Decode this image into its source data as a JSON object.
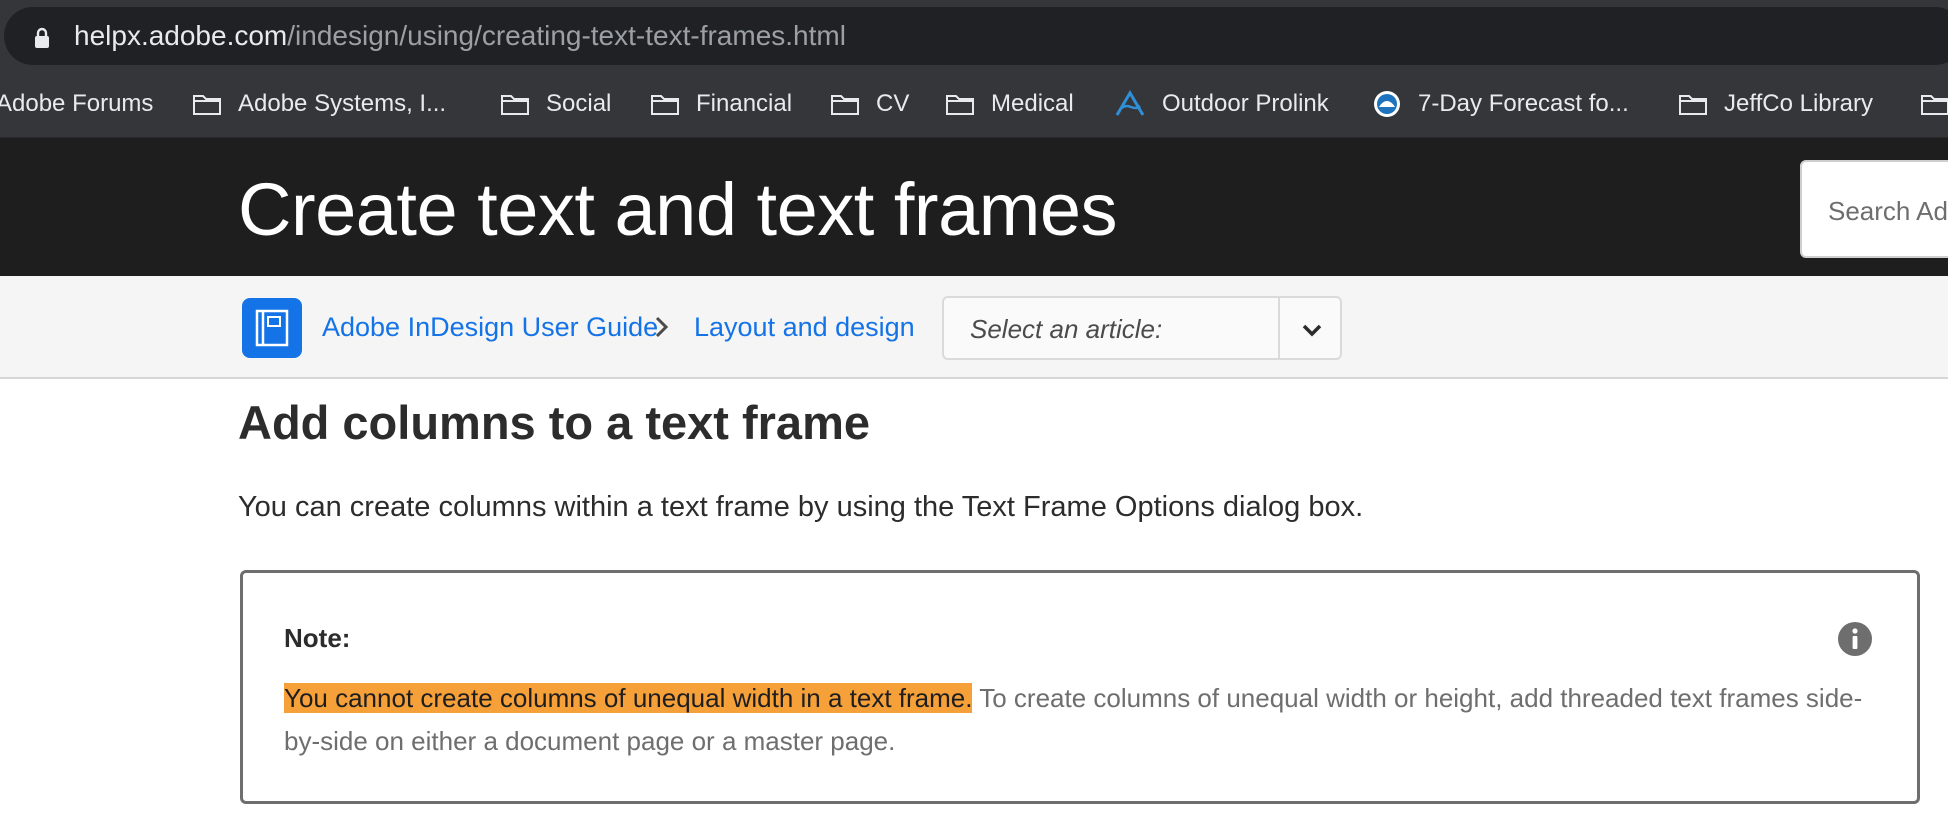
{
  "browser": {
    "url_host": "helpx.adobe.com",
    "url_path": "/indesign/using/creating-text-text-frames.html",
    "bookmarks": [
      {
        "label": "Adobe Forums",
        "icon": "none"
      },
      {
        "label": "Adobe Systems, I...",
        "icon": "folder-icon"
      },
      {
        "label": "Social",
        "icon": "folder-icon"
      },
      {
        "label": "Financial",
        "icon": "folder-icon"
      },
      {
        "label": "CV",
        "icon": "folder-icon"
      },
      {
        "label": "Medical",
        "icon": "folder-icon"
      },
      {
        "label": "Outdoor Prolink",
        "icon": "prolink-logo-icon"
      },
      {
        "label": "7-Day Forecast fo...",
        "icon": "noaa-logo-icon"
      },
      {
        "label": "JeffCo Library",
        "icon": "folder-icon"
      }
    ]
  },
  "header": {
    "title": "Create text and text frames",
    "search_placeholder": "Search Adobe"
  },
  "breadcrumb": {
    "guide_label": "Adobe InDesign User Guide",
    "section_label": "Layout and design",
    "article_select_placeholder": "Select an article:"
  },
  "main": {
    "heading": "Add columns to a text frame",
    "intro": "You can create columns within a text frame by using the Text Frame Options dialog box.",
    "note": {
      "label": "Note:",
      "highlighted_text": "You cannot create columns of unequal width in a text frame.",
      "body_text": " To create columns of unequal width or height, add threaded text frames side-by-side on either a document page or a master page."
    }
  },
  "colors": {
    "accent": "#1473e6",
    "highlight": "#f6a03a",
    "header_bg": "#1e1e1e",
    "chrome_bg": "#35363a"
  }
}
